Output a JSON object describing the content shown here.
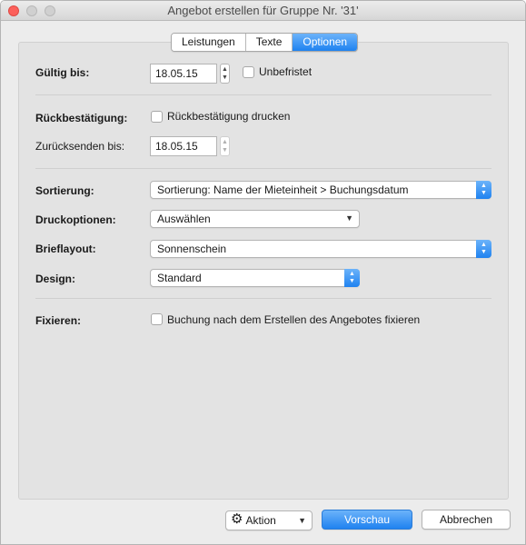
{
  "window": {
    "title": "Angebot erstellen für Gruppe Nr. '31'"
  },
  "tabs": [
    {
      "label": "Leistungen",
      "active": false
    },
    {
      "label": "Texte",
      "active": false
    },
    {
      "label": "Optionen",
      "active": true
    }
  ],
  "gueltig": {
    "label": "Gültig bis:",
    "date": "18.05.15",
    "unbefristet_label": "Unbefristet",
    "unbefristet_checked": false
  },
  "rueck": {
    "label": "Rückbestätigung:",
    "checkbox_label": "Rückbestätigung drucken",
    "checked": false,
    "zuruecksenden_label": "Zurücksenden bis:",
    "zuruecksenden_date": "18.05.15"
  },
  "sortierung": {
    "label": "Sortierung:",
    "value": "Sortierung: Name der Mieteinheit > Buchungsdatum"
  },
  "druckoptionen": {
    "label": "Druckoptionen:",
    "value": "Auswählen"
  },
  "brieflayout": {
    "label": "Brieflayout:",
    "value": "Sonnenschein"
  },
  "design": {
    "label": "Design:",
    "value": "Standard"
  },
  "fixieren": {
    "label": "Fixieren:",
    "checkbox_label": "Buchung nach dem Erstellen des Angebotes fixieren",
    "checked": false
  },
  "footer": {
    "action_label": "Aktion",
    "preview_label": "Vorschau",
    "cancel_label": "Abbrechen"
  },
  "colors": {
    "accent": "#1f82f0",
    "close": "#fc605b"
  },
  "icons": {
    "action": "gear-icon"
  }
}
